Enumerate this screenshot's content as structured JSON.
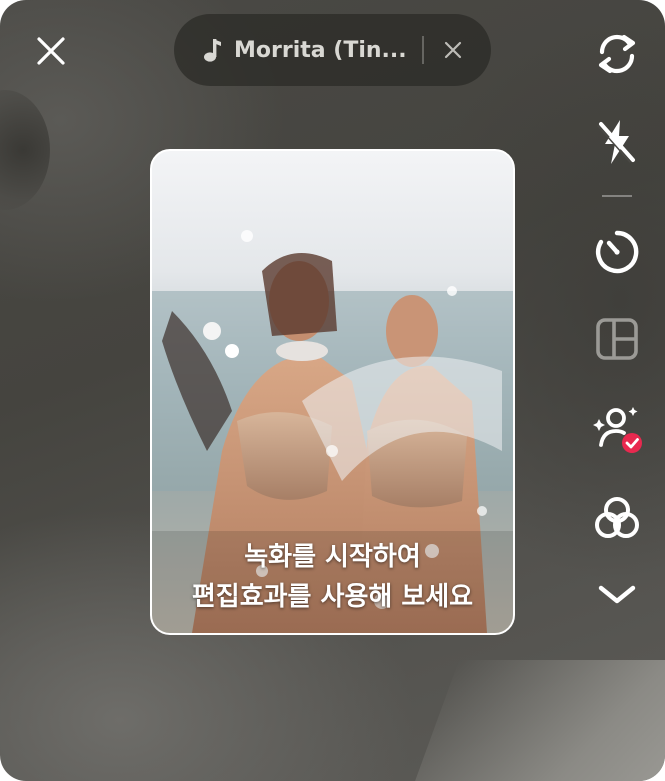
{
  "sound": {
    "title": "Morrita (Tin...",
    "icon": "music-note-icon"
  },
  "preview": {
    "caption_line1": "녹화를 시작하여",
    "caption_line2": "편집효과를 사용해 보세요"
  },
  "toolbar": {
    "tools": [
      {
        "icon": "flip-camera-icon",
        "enabled": true
      },
      {
        "icon": "flash-off-icon",
        "enabled": true
      },
      {
        "icon": "timer-icon",
        "enabled": true
      },
      {
        "icon": "layout-icon",
        "enabled": false
      },
      {
        "icon": "effects-person-icon",
        "badge": "check",
        "enabled": true
      },
      {
        "icon": "filters-icon",
        "enabled": true
      },
      {
        "icon": "chevron-down-icon",
        "enabled": true
      }
    ]
  },
  "colors": {
    "badge": "#e8294f",
    "icon": "#ffffff",
    "pill_bg": "#2a2926"
  }
}
